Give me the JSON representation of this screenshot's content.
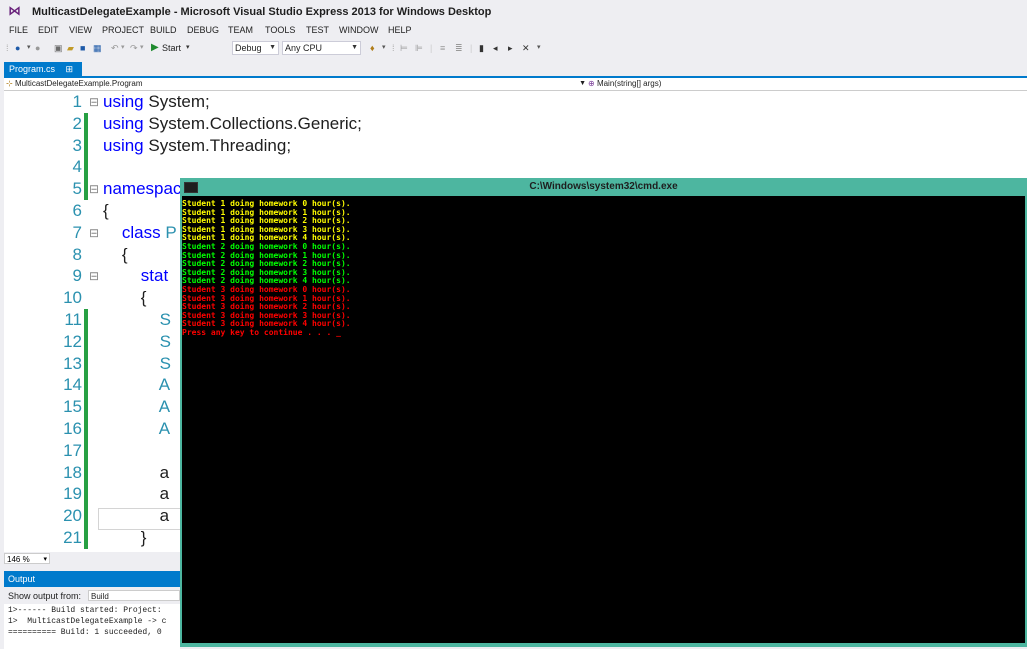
{
  "window": {
    "title": "MulticastDelegateExample - Microsoft Visual Studio Express 2013 for Windows Desktop"
  },
  "menu": [
    "FILE",
    "EDIT",
    "VIEW",
    "PROJECT",
    "BUILD",
    "DEBUG",
    "TEAM",
    "TOOLS",
    "TEST",
    "WINDOW",
    "HELP"
  ],
  "toolbar": {
    "start_label": "Start",
    "config": "Debug",
    "platform": "Any CPU"
  },
  "doc_tab": {
    "name": "Program.cs",
    "pin": "⊞",
    "close": "✕"
  },
  "navbar": {
    "class_combo": "MulticastDelegateExample.Program",
    "member_combo": "Main(string[] args)"
  },
  "code_lines": [
    {
      "num": "1",
      "fold": "⊟",
      "segments": [
        {
          "t": "using ",
          "c": "kw"
        },
        {
          "t": "System;",
          "c": ""
        }
      ]
    },
    {
      "num": "2",
      "fold": "",
      "segments": [
        {
          "t": "using ",
          "c": "kw"
        },
        {
          "t": "System.Collections.Generic;",
          "c": ""
        }
      ]
    },
    {
      "num": "3",
      "fold": "",
      "segments": [
        {
          "t": "using ",
          "c": "kw"
        },
        {
          "t": "System.Threading;",
          "c": ""
        }
      ]
    },
    {
      "num": "4",
      "fold": "",
      "segments": []
    },
    {
      "num": "5",
      "fold": "⊟",
      "segments": [
        {
          "t": "namespac",
          "c": "kw"
        }
      ]
    },
    {
      "num": "6",
      "fold": "",
      "segments": [
        {
          "t": "{",
          "c": ""
        }
      ]
    },
    {
      "num": "7",
      "fold": "⊟",
      "segments": [
        {
          "t": "    class ",
          "c": "kw"
        },
        {
          "t": "P",
          "c": "ty"
        }
      ]
    },
    {
      "num": "8",
      "fold": "",
      "segments": [
        {
          "t": "    {",
          "c": ""
        }
      ]
    },
    {
      "num": "9",
      "fold": "⊟",
      "segments": [
        {
          "t": "        stat",
          "c": "kw"
        }
      ]
    },
    {
      "num": "10",
      "fold": "",
      "segments": [
        {
          "t": "        {",
          "c": ""
        }
      ]
    },
    {
      "num": "11",
      "fold": "",
      "segments": [
        {
          "t": "            S",
          "c": "ty"
        }
      ]
    },
    {
      "num": "12",
      "fold": "",
      "segments": [
        {
          "t": "            S",
          "c": "ty"
        }
      ]
    },
    {
      "num": "13",
      "fold": "",
      "segments": [
        {
          "t": "            S",
          "c": "ty"
        }
      ]
    },
    {
      "num": "14",
      "fold": "",
      "segments": [
        {
          "t": "            A",
          "c": "ty"
        }
      ]
    },
    {
      "num": "15",
      "fold": "",
      "segments": [
        {
          "t": "            A",
          "c": "ty"
        }
      ]
    },
    {
      "num": "16",
      "fold": "",
      "segments": [
        {
          "t": "            A",
          "c": "ty"
        }
      ]
    },
    {
      "num": "17",
      "fold": "",
      "segments": []
    },
    {
      "num": "18",
      "fold": "",
      "segments": [
        {
          "t": "            a",
          "c": ""
        }
      ]
    },
    {
      "num": "19",
      "fold": "",
      "segments": [
        {
          "t": "            a",
          "c": ""
        }
      ]
    },
    {
      "num": "20",
      "fold": "",
      "segments": [
        {
          "t": "            a",
          "c": ""
        }
      ]
    },
    {
      "num": "21",
      "fold": "",
      "segments": [
        {
          "t": "        }",
          "c": ""
        }
      ]
    }
  ],
  "zoom": "146 %",
  "output": {
    "title": "Output",
    "show_from_label": "Show output from:",
    "show_from_value": "Build",
    "lines": [
      "1>------ Build started: Project:",
      "1>  MulticastDelegateExample -> c",
      "========== Build: 1 succeeded, 0"
    ]
  },
  "console": {
    "title": "C:\\Windows\\system32\\cmd.exe",
    "lines": [
      {
        "text": "Student 1 doing homework 0 hour(s).",
        "color": "#ffff00"
      },
      {
        "text": "Student 1 doing homework 1 hour(s).",
        "color": "#ffff00"
      },
      {
        "text": "Student 1 doing homework 2 hour(s).",
        "color": "#ffff00"
      },
      {
        "text": "Student 1 doing homework 3 hour(s).",
        "color": "#ffff00"
      },
      {
        "text": "Student 1 doing homework 4 hour(s).",
        "color": "#ffff00"
      },
      {
        "text": "Student 2 doing homework 0 hour(s).",
        "color": "#00ff00"
      },
      {
        "text": "Student 2 doing homework 1 hour(s).",
        "color": "#00ff00"
      },
      {
        "text": "Student 2 doing homework 2 hour(s).",
        "color": "#00ff00"
      },
      {
        "text": "Student 2 doing homework 3 hour(s).",
        "color": "#00ff00"
      },
      {
        "text": "Student 2 doing homework 4 hour(s).",
        "color": "#00ff00"
      },
      {
        "text": "Student 3 doing homework 0 hour(s).",
        "color": "#ff0000"
      },
      {
        "text": "Student 3 doing homework 1 hour(s).",
        "color": "#ff0000"
      },
      {
        "text": "Student 3 doing homework 2 hour(s).",
        "color": "#ff0000"
      },
      {
        "text": "Student 3 doing homework 3 hour(s).",
        "color": "#ff0000"
      },
      {
        "text": "Student 3 doing homework 4 hour(s).",
        "color": "#ff0000"
      },
      {
        "text": "Press any key to continue . . . _",
        "color": "#ff0000"
      }
    ]
  },
  "colors": {
    "accent": "#007acc",
    "change_bar": "#27a043",
    "keyword": "#0000ff",
    "type": "#2b91af",
    "console_frame": "#4db6a0"
  }
}
